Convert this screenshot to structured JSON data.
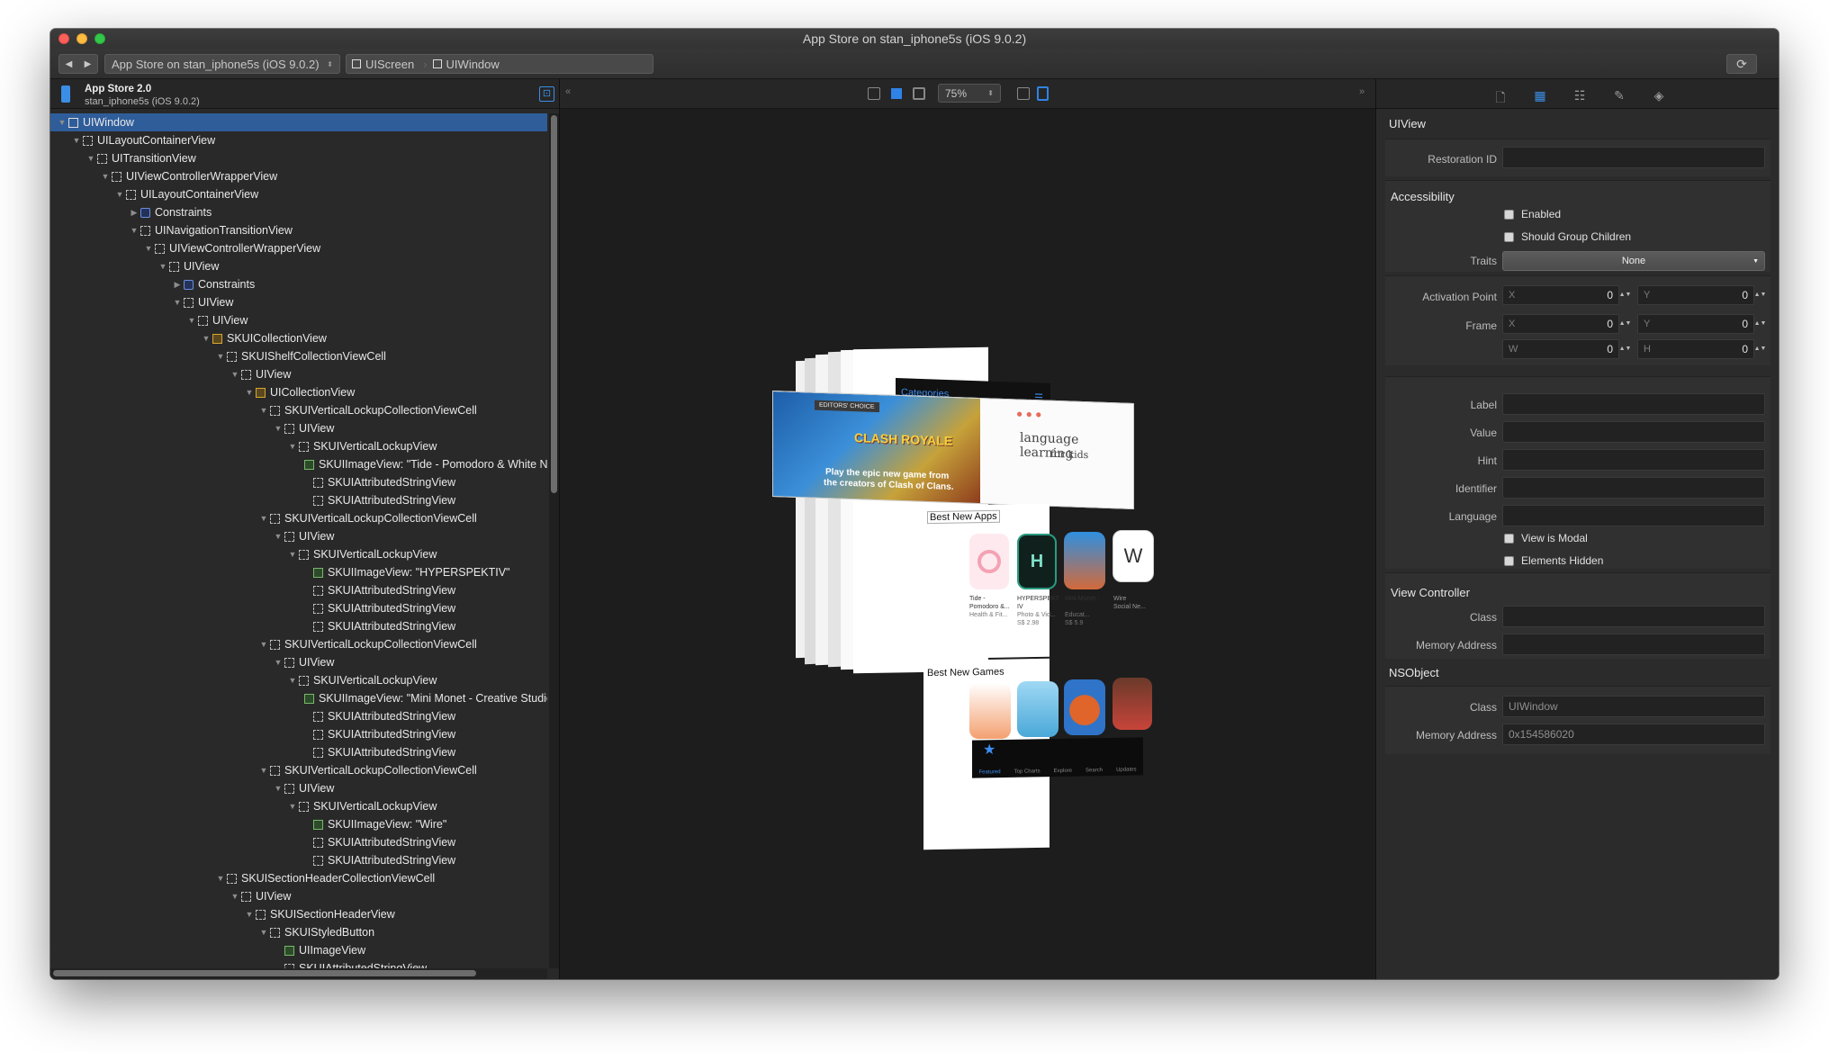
{
  "window": {
    "title": "App Store on stan_iphone5s (iOS 9.0.2)"
  },
  "toolbar": {
    "process": "App Store on stan_iphone5s (iOS 9.0.2)",
    "breadcrumb": [
      "UIScreen",
      "UIWindow"
    ]
  },
  "left_header": {
    "app_name": "App Store 2.0",
    "device": "stan_iphone5s (iOS 9.0.2)"
  },
  "tree": [
    {
      "label": "UIWindow",
      "depth": 0,
      "icon": "solid",
      "open": true,
      "sel": true
    },
    {
      "label": "UILayoutContainerView",
      "depth": 1,
      "icon": "dashed",
      "open": true
    },
    {
      "label": "UITransitionView",
      "depth": 2,
      "icon": "dashed",
      "open": true
    },
    {
      "label": "UIViewControllerWrapperView",
      "depth": 3,
      "icon": "dashed",
      "open": true
    },
    {
      "label": "UILayoutContainerView",
      "depth": 4,
      "icon": "dashed",
      "open": true
    },
    {
      "label": "Constraints",
      "depth": 5,
      "icon": "cons",
      "open": false
    },
    {
      "label": "UINavigationTransitionView",
      "depth": 5,
      "icon": "dashed",
      "open": true
    },
    {
      "label": "UIViewControllerWrapperView",
      "depth": 6,
      "icon": "dashed",
      "open": true
    },
    {
      "label": "UIView",
      "depth": 7,
      "icon": "dashed",
      "open": true
    },
    {
      "label": "Constraints",
      "depth": 8,
      "icon": "cons",
      "open": false
    },
    {
      "label": "UIView",
      "depth": 8,
      "icon": "dashed",
      "open": true
    },
    {
      "label": "UIView",
      "depth": 9,
      "icon": "dashed",
      "open": true
    },
    {
      "label": "SKUICollectionView",
      "depth": 10,
      "icon": "coll",
      "open": true
    },
    {
      "label": "SKUIShelfCollectionViewCell",
      "depth": 11,
      "icon": "dashed",
      "open": true
    },
    {
      "label": "UIView",
      "depth": 12,
      "icon": "dashed",
      "open": true
    },
    {
      "label": "UICollectionView",
      "depth": 13,
      "icon": "coll",
      "open": true
    },
    {
      "label": "SKUIVerticalLockupCollectionViewCell",
      "depth": 14,
      "icon": "dashed",
      "open": true
    },
    {
      "label": "UIView",
      "depth": 15,
      "icon": "dashed",
      "open": true
    },
    {
      "label": "SKUIVerticalLockupView",
      "depth": 16,
      "icon": "dashed",
      "open": true
    },
    {
      "label": "SKUIImageView: \"Tide - Pomodoro & White Noise\"",
      "depth": 17,
      "icon": "img",
      "open": null
    },
    {
      "label": "SKUIAttributedStringView",
      "depth": 17,
      "icon": "dashed",
      "open": null
    },
    {
      "label": "SKUIAttributedStringView",
      "depth": 17,
      "icon": "dashed",
      "open": null
    },
    {
      "label": "SKUIVerticalLockupCollectionViewCell",
      "depth": 14,
      "icon": "dashed",
      "open": true
    },
    {
      "label": "UIView",
      "depth": 15,
      "icon": "dashed",
      "open": true
    },
    {
      "label": "SKUIVerticalLockupView",
      "depth": 16,
      "icon": "dashed",
      "open": true
    },
    {
      "label": "SKUIImageView: \"HYPERSPEKTIV\"",
      "depth": 17,
      "icon": "img",
      "open": null
    },
    {
      "label": "SKUIAttributedStringView",
      "depth": 17,
      "icon": "dashed",
      "open": null
    },
    {
      "label": "SKUIAttributedStringView",
      "depth": 17,
      "icon": "dashed",
      "open": null
    },
    {
      "label": "SKUIAttributedStringView",
      "depth": 17,
      "icon": "dashed",
      "open": null
    },
    {
      "label": "SKUIVerticalLockupCollectionViewCell",
      "depth": 14,
      "icon": "dashed",
      "open": true
    },
    {
      "label": "UIView",
      "depth": 15,
      "icon": "dashed",
      "open": true
    },
    {
      "label": "SKUIVerticalLockupView",
      "depth": 16,
      "icon": "dashed",
      "open": true
    },
    {
      "label": "SKUIImageView: \"Mini Monet - Creative Studio\"",
      "depth": 17,
      "icon": "img",
      "open": null
    },
    {
      "label": "SKUIAttributedStringView",
      "depth": 17,
      "icon": "dashed",
      "open": null
    },
    {
      "label": "SKUIAttributedStringView",
      "depth": 17,
      "icon": "dashed",
      "open": null
    },
    {
      "label": "SKUIAttributedStringView",
      "depth": 17,
      "icon": "dashed",
      "open": null
    },
    {
      "label": "SKUIVerticalLockupCollectionViewCell",
      "depth": 14,
      "icon": "dashed",
      "open": true
    },
    {
      "label": "UIView",
      "depth": 15,
      "icon": "dashed",
      "open": true
    },
    {
      "label": "SKUIVerticalLockupView",
      "depth": 16,
      "icon": "dashed",
      "open": true
    },
    {
      "label": "SKUIImageView: \"Wire\"",
      "depth": 17,
      "icon": "img",
      "open": null
    },
    {
      "label": "SKUIAttributedStringView",
      "depth": 17,
      "icon": "dashed",
      "open": null
    },
    {
      "label": "SKUIAttributedStringView",
      "depth": 17,
      "icon": "dashed",
      "open": null
    },
    {
      "label": "SKUISectionHeaderCollectionViewCell",
      "depth": 11,
      "icon": "dashed",
      "open": true
    },
    {
      "label": "UIView",
      "depth": 12,
      "icon": "dashed",
      "open": true
    },
    {
      "label": "SKUISectionHeaderView",
      "depth": 13,
      "icon": "dashed",
      "open": true
    },
    {
      "label": "SKUIStyledButton",
      "depth": 14,
      "icon": "dashed",
      "open": true
    },
    {
      "label": "UIImageView",
      "depth": 15,
      "icon": "img",
      "open": null
    },
    {
      "label": "SKUIAttributedStringView",
      "depth": 15,
      "icon": "dashed",
      "open": null
    }
  ],
  "canvas": {
    "zoom": "75%",
    "preview": {
      "categories_label": "Categories",
      "editors_choice": "EDITORS' CHOICE",
      "game_logo": "CLASH ROYALE",
      "banner_caption_1": "Play the epic new game from",
      "banner_caption_2": "the creators of Clash of Clans.",
      "language_title": "language learning",
      "language_sub": "for kids",
      "section_1": "Best New Apps",
      "section_2": "Best New Games",
      "apps": [
        {
          "name": "Tide - Pomodoro &...",
          "cat": "Health & Fit...",
          "price": ""
        },
        {
          "name": "HYPERSPEKT IV",
          "cat": "Photo & Vid...",
          "price": "S$ 2.98"
        },
        {
          "name": "Mini Monet - Creative...",
          "cat": "Educat...",
          "price": "S$ 5.9"
        },
        {
          "name": "Wire",
          "cat": "Social Ne...",
          "price": ""
        }
      ],
      "tabs": [
        "Featured",
        "Top Charts",
        "Explore",
        "Search",
        "Updates"
      ]
    }
  },
  "inspector": {
    "class_title": "UIView",
    "restoration_id_label": "Restoration ID",
    "accessibility": {
      "header": "Accessibility",
      "enabled": "Enabled",
      "group_children": "Should Group Children",
      "traits_label": "Traits",
      "traits_value": "None"
    },
    "activation_point_label": "Activation Point",
    "frame_label": "Frame",
    "x": "X",
    "y": "Y",
    "w": "W",
    "h": "H",
    "ap_x": "0",
    "ap_y": "0",
    "fx": "0",
    "fy": "0",
    "fw": "0",
    "fh": "0",
    "label_label": "Label",
    "value_label": "Value",
    "hint_label": "Hint",
    "identifier_label": "Identifier",
    "language_label": "Language",
    "view_is_modal": "View is Modal",
    "elements_hidden": "Elements Hidden",
    "view_controller": {
      "header": "View Controller",
      "class_label": "Class",
      "memory_label": "Memory Address"
    },
    "nsobject": {
      "header": "NSObject",
      "class_label": "Class",
      "class_value": "UIWindow",
      "memory_label": "Memory Address",
      "memory_value": "0x154586020"
    }
  }
}
